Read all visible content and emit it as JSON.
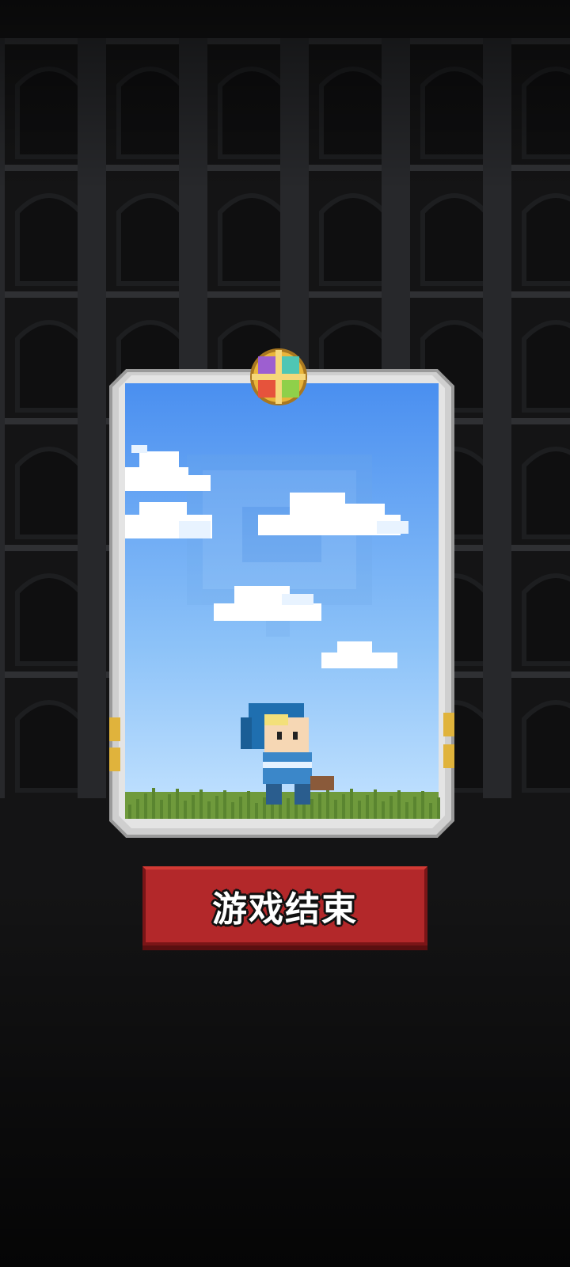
{
  "screen": "game-over",
  "card": {
    "scene": "sky-with-clouds-and-grass",
    "character": "blue-hooded-adventurer",
    "emblem_icon": "four-color-cross-emblem"
  },
  "buttons": {
    "game_over_label": "游戏结束"
  },
  "colors": {
    "background": "#0b0b0c",
    "wall": "#2a2b2e",
    "sky_top": "#4a8ff0",
    "sky_bottom": "#bfe0ff",
    "frame": "#d9d9d9",
    "button": "#b3282a"
  }
}
